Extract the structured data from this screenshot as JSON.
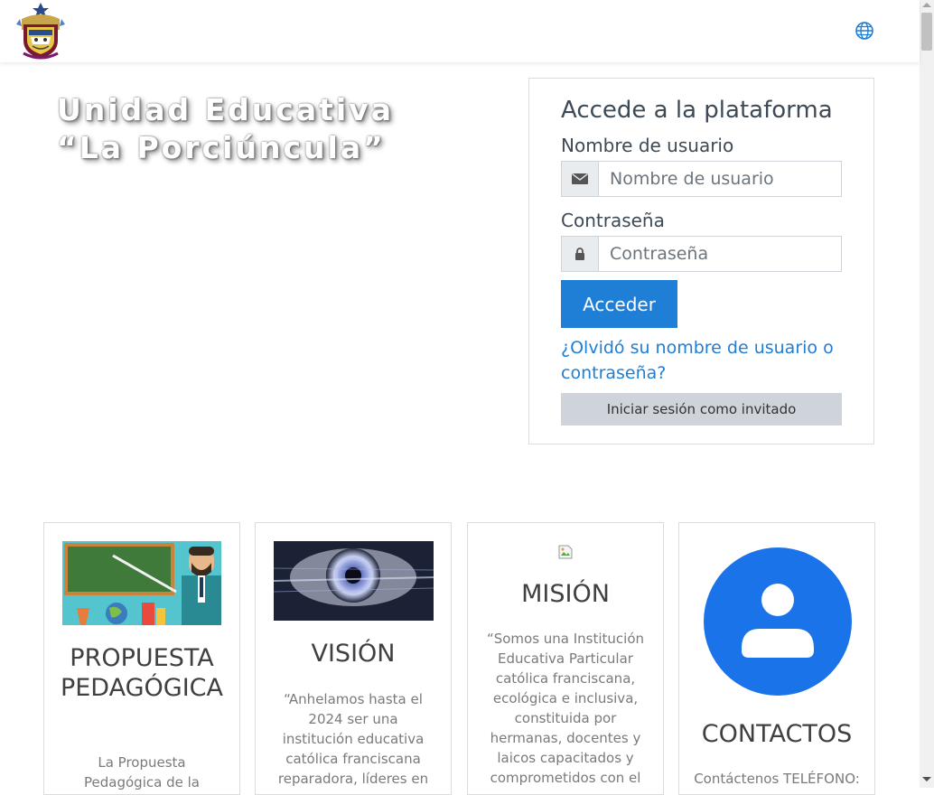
{
  "header": {
    "logo_icon": "school-crest-logo",
    "language_icon": "globe-icon"
  },
  "hero": {
    "title": "Unidad Educativa “La Porciúncula”"
  },
  "login": {
    "heading": "Accede a la plataforma",
    "username_label": "Nombre de usuario",
    "username_placeholder": "Nombre de usuario",
    "username_icon": "envelope-icon",
    "password_label": "Contraseña",
    "password_placeholder": "Contraseña",
    "password_icon": "lock-icon",
    "submit_label": "Acceder",
    "forgot_link": "¿Olvidó su nombre de usuario o contraseña?",
    "guest_button": "Iniciar sesión como invitado"
  },
  "cards": [
    {
      "title": "PROPUESTA PEDAGÓGICA",
      "text": "La Propuesta Pedagógica de la",
      "image": "teacher-illustration"
    },
    {
      "title": "VISIÓN",
      "text": "“Anhelamos hasta el 2024 ser una institución educativa católica franciscana reparadora, líderes en",
      "image": "eye-image"
    },
    {
      "title": "MISIÓN",
      "text": "“Somos una Institución Educativa Particular católica franciscana, ecológica e inclusiva, constituida por hermanas, docentes y laicos capacitados y comprometidos con el",
      "image": "broken-image-icon"
    },
    {
      "title": "CONTACTOS",
      "text": "Contáctenos TELÉFONO:",
      "image": "contact-avatar-icon"
    }
  ],
  "colors": {
    "primary": "#1f7ed6",
    "guest_button": "#ced4da",
    "contact_avatar": "#1a73e8"
  }
}
